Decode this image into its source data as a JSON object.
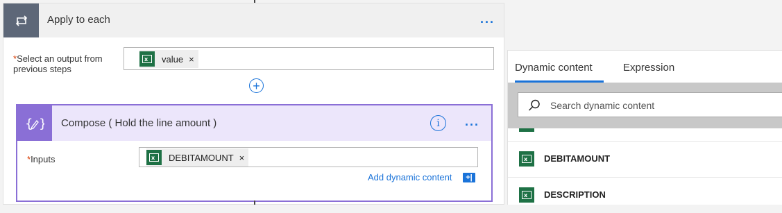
{
  "apply_to_each": {
    "title": "Apply to each",
    "field_label": "Select an output from previous steps",
    "required_mark": "*",
    "token": {
      "label": "value",
      "remove": "×",
      "icon": "excel-icon"
    }
  },
  "compose": {
    "title": "Compose ( Hold the line amount )",
    "inputs_label": "Inputs",
    "required_mark": "*",
    "token": {
      "label": "DEBITAMOUNT",
      "remove": "×",
      "icon": "excel-icon"
    },
    "add_dynamic_content": "Add dynamic content",
    "info_glyph": "i"
  },
  "dynamic_panel": {
    "tabs": [
      {
        "label": "Dynamic content",
        "active": true
      },
      {
        "label": "Expression",
        "active": false
      }
    ],
    "search_placeholder": "Search dynamic content",
    "items": [
      {
        "label": "DEBITAMOUNT",
        "icon": "excel-icon"
      },
      {
        "label": "DESCRIPTION",
        "icon": "excel-icon"
      }
    ]
  },
  "colors": {
    "accent": "#1a73d9",
    "apply_header_icon_bg": "#5d6778",
    "compose_accent": "#8a6fd6",
    "compose_header_bg": "#ece6fb",
    "excel_green": "#1e7145",
    "required": "#d83b01"
  }
}
